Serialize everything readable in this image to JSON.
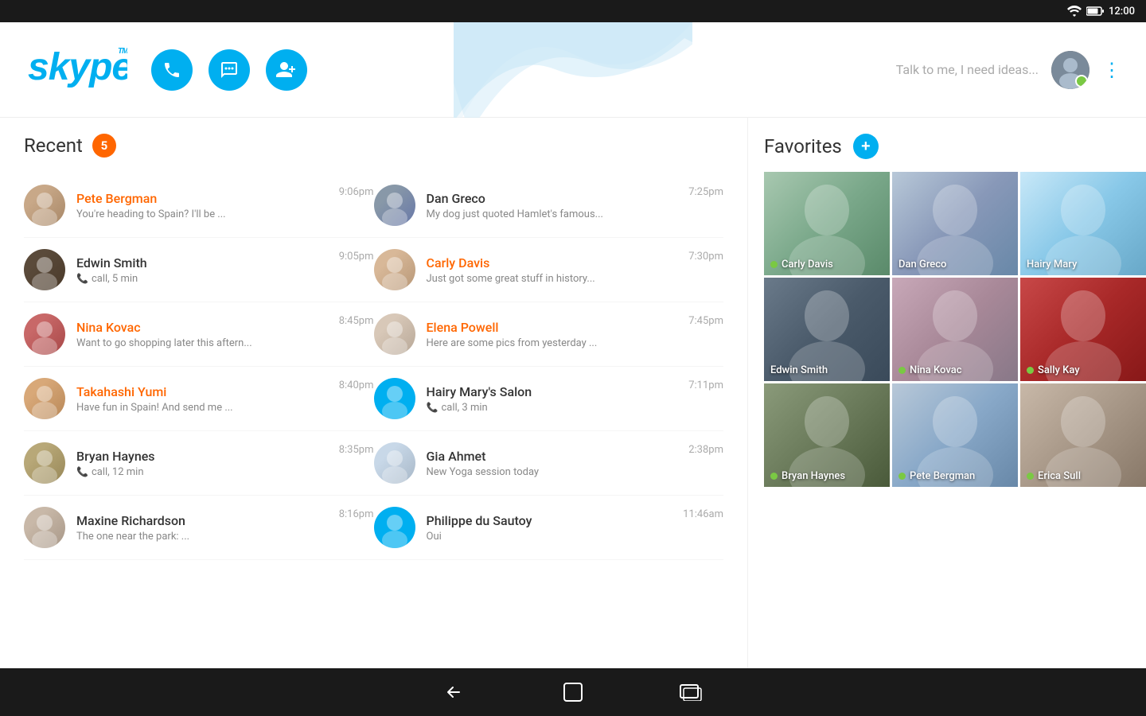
{
  "statusBar": {
    "time": "12:00"
  },
  "header": {
    "logo": "skype",
    "searchPlaceholder": "Talk to me, I need ideas...",
    "buttons": {
      "call": "📞",
      "message": "💬",
      "addContact": "👤+"
    }
  },
  "recent": {
    "title": "Recent",
    "count": "5",
    "contacts": [
      {
        "name": "Pete Bergman",
        "preview": "You're heading to Spain? I'll be ...",
        "time": "9:06pm",
        "active": true,
        "avatarClass": "avatar-bg-1"
      },
      {
        "name": "Dan Greco",
        "preview": "My dog just quoted Hamlet's famous...",
        "time": "7:25pm",
        "active": false,
        "avatarClass": "avatar-bg-8"
      },
      {
        "name": "Edwin Smith",
        "preview": "call, 5 min",
        "time": "9:05pm",
        "active": false,
        "avatarClass": "avatar-bg-2",
        "isCall": true
      },
      {
        "name": "Carly Davis",
        "preview": "Just got some great stuff in history...",
        "time": "7:30pm",
        "active": true,
        "avatarClass": "avatar-bg-5"
      },
      {
        "name": "Nina Kovac",
        "preview": "Want to go shopping later this aftern...",
        "time": "8:45pm",
        "active": true,
        "avatarClass": "avatar-bg-3"
      },
      {
        "name": "Elena Powell",
        "preview": "Here are some pics from yesterday ...",
        "time": "7:45pm",
        "active": true,
        "avatarClass": "avatar-bg-9"
      },
      {
        "name": "Takahashi Yumi",
        "preview": "Have fun in Spain! And send me ...",
        "time": "8:40pm",
        "active": true,
        "avatarClass": "avatar-bg-4"
      },
      {
        "name": "Hairy Mary's Salon",
        "preview": "call, 3 min",
        "time": "7:11pm",
        "active": false,
        "avatarClass": "placeholder",
        "isCall": true
      },
      {
        "name": "Bryan Haynes",
        "preview": "call, 12 min",
        "time": "8:35pm",
        "active": false,
        "avatarClass": "avatar-bg-6",
        "isCall": true
      },
      {
        "name": "Gia Ahmet",
        "preview": "New Yoga session today",
        "time": "2:38pm",
        "active": false,
        "avatarClass": "avatar-bg-7"
      },
      {
        "name": "Maxine Richardson",
        "preview": "The one near the park: ...",
        "time": "8:16pm",
        "active": false,
        "avatarClass": "avatar-bg-10"
      },
      {
        "name": "Philippe du Sautoy",
        "preview": "Oui",
        "time": "11:46am",
        "active": false,
        "avatarClass": "placeholder"
      }
    ]
  },
  "favorites": {
    "title": "Favorites",
    "addLabel": "+",
    "items": [
      {
        "name": "Carly Davis",
        "online": true,
        "bgClass": "fav-carly"
      },
      {
        "name": "Dan Greco",
        "online": false,
        "bgClass": "fav-dan"
      },
      {
        "name": "Hairy Mary",
        "online": false,
        "bgClass": "fav-hairy"
      },
      {
        "name": "Edwin Smith",
        "online": false,
        "bgClass": "fav-edwin"
      },
      {
        "name": "Nina Kovac",
        "online": true,
        "bgClass": "fav-nina"
      },
      {
        "name": "Sally Kay",
        "online": true,
        "bgClass": "fav-sally"
      },
      {
        "name": "Bryan Haynes",
        "online": true,
        "bgClass": "fav-bryan"
      },
      {
        "name": "Pete Bergman",
        "online": true,
        "bgClass": "fav-pete"
      },
      {
        "name": "Erica Sull",
        "online": true,
        "bgClass": "fav-erica"
      }
    ]
  },
  "bottomNav": {
    "back": "←",
    "home": "⬜",
    "recents": "▭"
  }
}
